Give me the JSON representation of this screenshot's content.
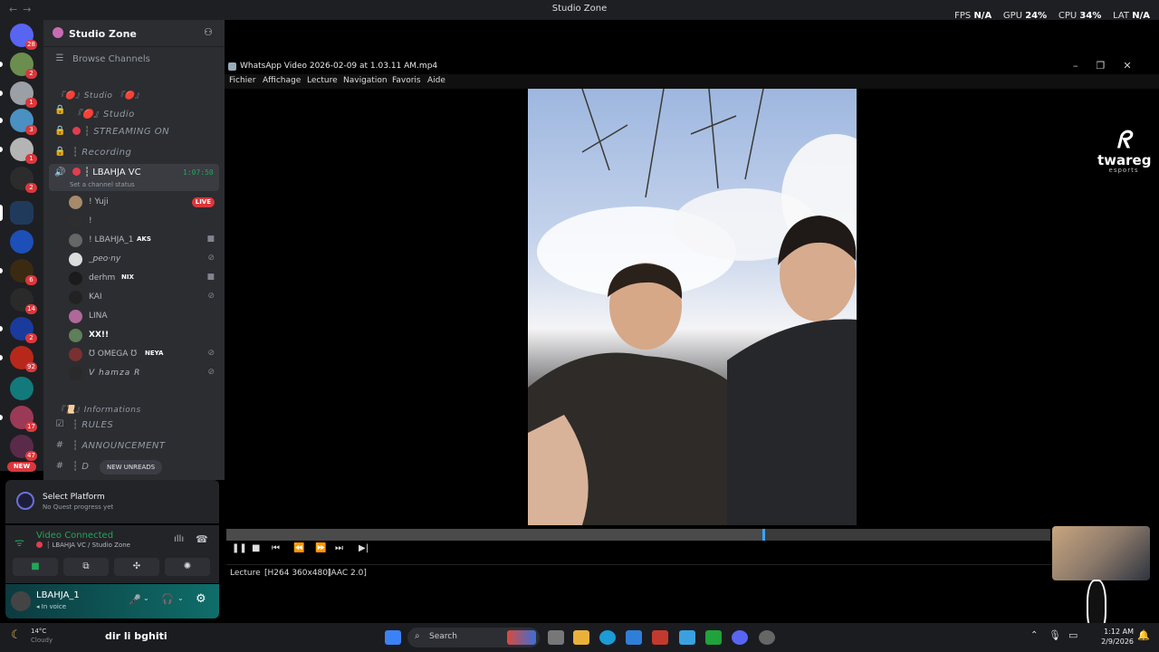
{
  "window_title": "Studio Zone",
  "stats": {
    "fps_label": "FPS",
    "fps": "N/A",
    "gpu_label": "GPU",
    "gpu": "24%",
    "cpu_label": "CPU",
    "cpu": "34%",
    "lat_label": "LAT",
    "lat": "N/A"
  },
  "server_rail": {
    "badges": [
      "28",
      "2",
      "1",
      "3",
      "1",
      "2",
      "6",
      "14",
      "2",
      "92",
      "17",
      "47"
    ],
    "new_label": "NEW"
  },
  "sidebar": {
    "server_name": "Studio Zone",
    "browse_channels": "Browse Channels",
    "category_studio": "『🔴』Studio 『🔴』",
    "channels": [
      {
        "name": "『🔴』Studio"
      },
      {
        "name": "┆ STREAMING ON"
      },
      {
        "name": "┆ Recording"
      }
    ],
    "active_voice": {
      "name": "┆ LBAHJA VC",
      "timer": "1:07:50",
      "status_hint": "Set a channel status"
    },
    "voice_users": [
      {
        "name": "! Yuji",
        "tag": "LIVE"
      },
      {
        "name": "!",
        "tag": ""
      },
      {
        "name": "! LBAHJA_1",
        "tag": "AKS"
      },
      {
        "name": "_peo·ny",
        "tag": ""
      },
      {
        "name": "derhm",
        "tag": "NIX"
      },
      {
        "name": "KAI",
        "tag": ""
      },
      {
        "name": "LINA",
        "tag": ""
      },
      {
        "name": "XX!!",
        "tag": ""
      },
      {
        "name": "℧ OMEGA ℧",
        "tag": "NEYA"
      },
      {
        "name": "V hamza R",
        "tag": ""
      }
    ],
    "category_info": "『📜』Informations",
    "info_channels": [
      {
        "name": "┆ RULES"
      },
      {
        "name": "┆ ANNOUNCEMENT"
      },
      {
        "name": "┆ D"
      }
    ],
    "new_unreads": "NEW UNREADS"
  },
  "platform": {
    "title": "Select Platform",
    "subtitle": "No Quest progress yet"
  },
  "voice_panel": {
    "status": "Video Connected",
    "location": "┆ LBAHJA VC / Studio Zone"
  },
  "user_bar": {
    "username": "LBAHJA_1",
    "state": "In voice"
  },
  "player": {
    "file_title": "WhatsApp Video 2026-02-09 at 1.03.11 AM.mp4",
    "menu": [
      "Fichier",
      "Affichage",
      "Lecture",
      "Navigation",
      "Favoris",
      "Aide"
    ],
    "progress": 0.65,
    "status": [
      "Lecture",
      "[H264 360x480]",
      "[AAC 2.0]"
    ]
  },
  "overlay_logo": {
    "brand": "twareg",
    "sub": "esports"
  },
  "taskbar": {
    "weather_temp": "14°C",
    "weather_text": "Cloudy",
    "caption": "dir li bghiti",
    "search_label": "Search",
    "time": "1:12 AM",
    "date": "2/9/2026"
  }
}
